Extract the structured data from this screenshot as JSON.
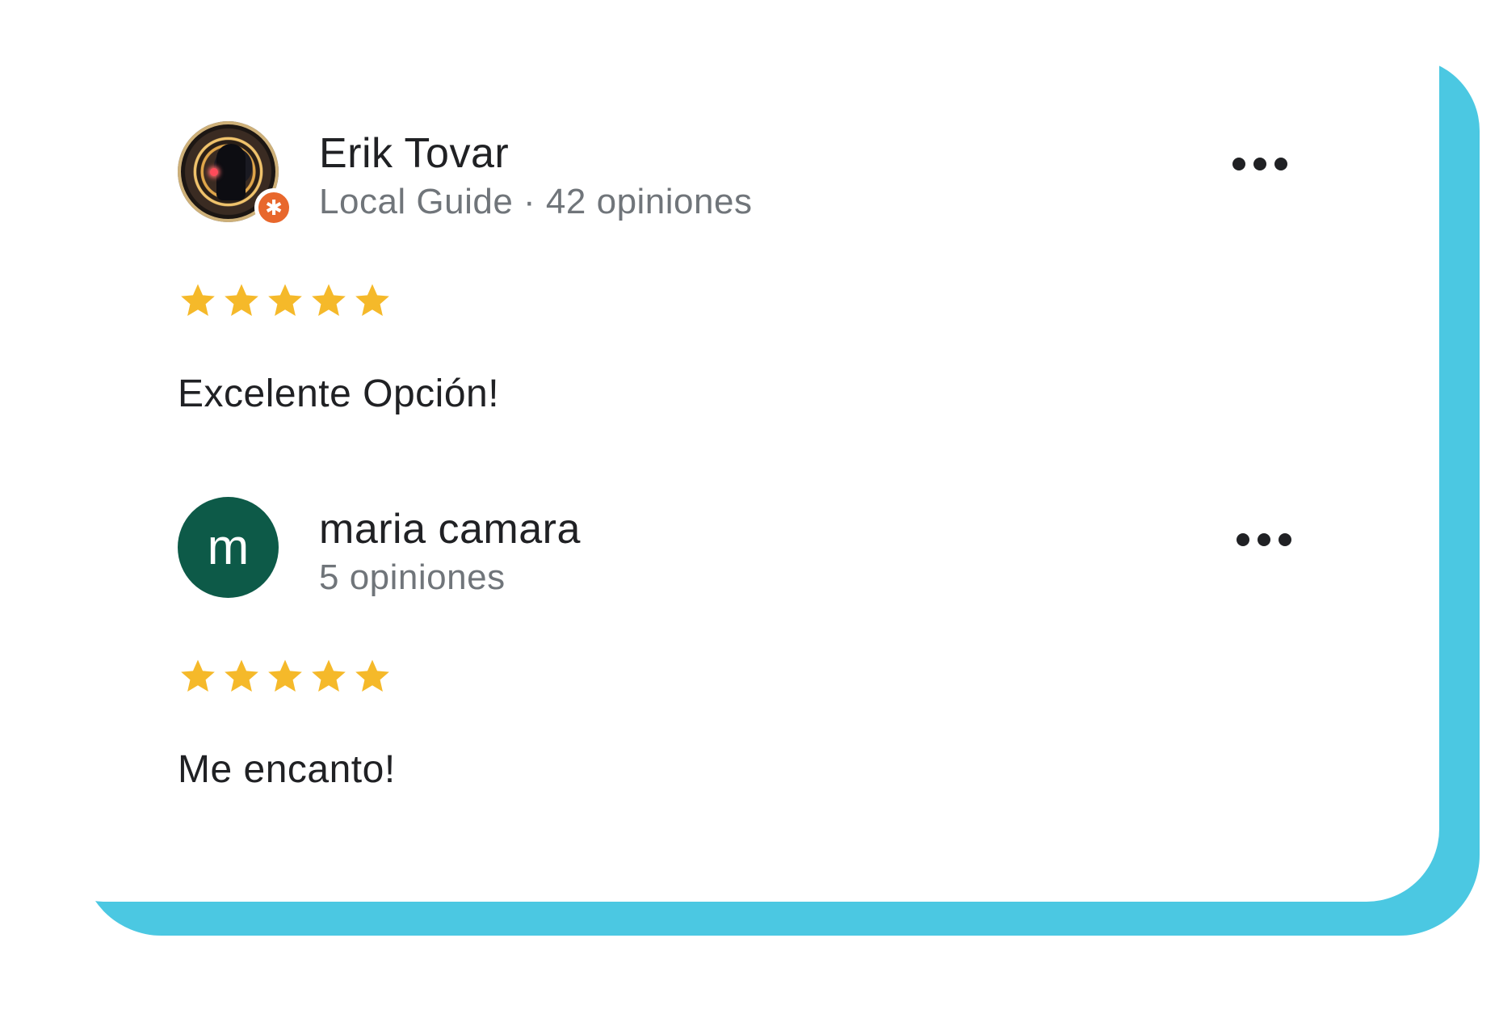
{
  "colors": {
    "accent_shadow": "#4bc8e2",
    "star": "#f5b92a",
    "local_guide_badge": "#e8672c",
    "letter_avatar": "#0d5a48"
  },
  "reviews": [
    {
      "author": "Erik Tovar",
      "meta": "Local Guide · 42 opiniones",
      "avatar": "photo",
      "badge_icon": "local-guide-star-icon",
      "rating": 5,
      "text": "Excelente Opción!",
      "menu_icon": "more-options-icon"
    },
    {
      "author": "maria camara",
      "meta": "5 opiniones",
      "avatar_letter": "m",
      "rating": 5,
      "text": "Me encanto!",
      "menu_icon": "more-options-icon"
    }
  ]
}
